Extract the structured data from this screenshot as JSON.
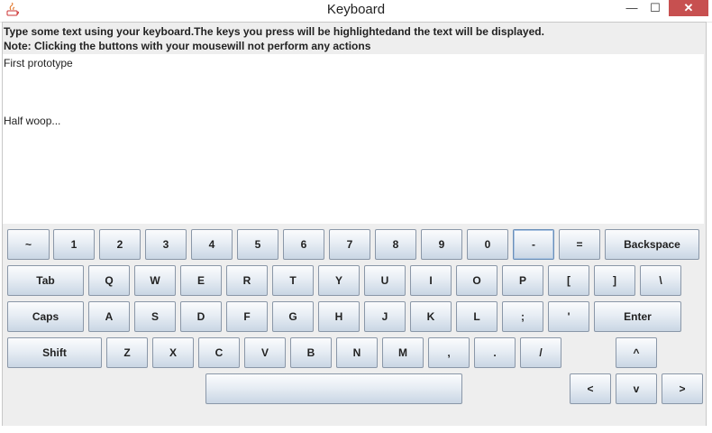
{
  "window": {
    "title": "Keyboard",
    "minimize_label": "—",
    "maximize_label": "☐",
    "close_label": "✕"
  },
  "instructions": {
    "line1": "Type some text using your keyboard.The keys you press will be highlightedand the text will be displayed.",
    "line2": "Note: Clicking the buttons with your mousewill not perform any actions"
  },
  "text_area": {
    "line1": "First prototype",
    "line2": "Half woop..."
  },
  "keys": {
    "tilde": "~",
    "k1": "1",
    "k2": "2",
    "k3": "3",
    "k4": "4",
    "k5": "5",
    "k6": "6",
    "k7": "7",
    "k8": "8",
    "k9": "9",
    "k0": "0",
    "minus": "-",
    "equals": "=",
    "backspace": "Backspace",
    "tab": "Tab",
    "q": "Q",
    "w": "W",
    "e": "E",
    "r": "R",
    "t": "T",
    "y": "Y",
    "u": "U",
    "i": "I",
    "o": "O",
    "p": "P",
    "lbracket": "[",
    "rbracket": "]",
    "backslash": "\\",
    "caps": "Caps",
    "a": "A",
    "s": "S",
    "d": "D",
    "f": "F",
    "g": "G",
    "h": "H",
    "j": "J",
    "k": "K",
    "l": "L",
    "semicolon": ";",
    "quote": "'",
    "enter": "Enter",
    "shift": "Shift",
    "z": "Z",
    "x": "X",
    "c": "C",
    "v": "V",
    "b": "B",
    "n": "N",
    "m": "M",
    "comma": ",",
    "period": ".",
    "slash": "/",
    "up": "^",
    "left": "<",
    "down": "v",
    "right": ">",
    "space": ""
  }
}
